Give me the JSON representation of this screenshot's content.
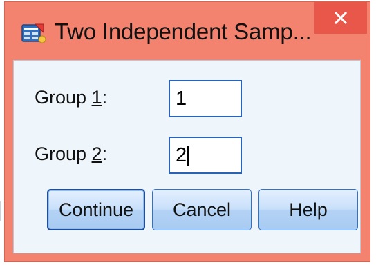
{
  "window": {
    "title": "Two Independent Samp...",
    "icon": "spss-dialog-icon",
    "close_icon": "close-icon",
    "colors": {
      "frame": "#f3836e",
      "close": "#e8574a",
      "client": "#eef5fb",
      "input_border": "#2a62b8",
      "button_border": "#2f73c9"
    }
  },
  "fields": {
    "group1": {
      "label_prefix": "Group ",
      "label_mnemonic": "1",
      "label_suffix": ":",
      "value": "1"
    },
    "group2": {
      "label_prefix": "Group ",
      "label_mnemonic": "2",
      "label_suffix": ":",
      "value": "2"
    }
  },
  "buttons": {
    "continue": "Continue",
    "cancel": "Cancel",
    "help": "Help"
  }
}
